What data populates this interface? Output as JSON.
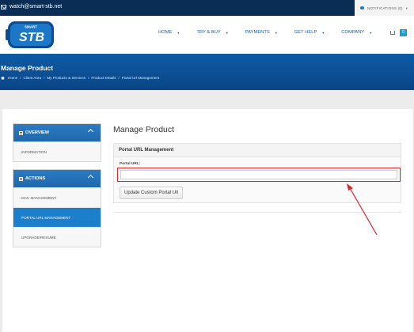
{
  "topbar": {
    "email": "watch@smart-stb.net",
    "notifications_label": "NOTIFICATIONS (0)"
  },
  "logo": {
    "top_text": "SMART",
    "main_text": "STB"
  },
  "nav": {
    "items": [
      {
        "label": "HOME"
      },
      {
        "label": "TRY & BUY"
      },
      {
        "label": "PAYMENTS"
      },
      {
        "label": "GET HELP"
      },
      {
        "label": "COMPANY"
      }
    ],
    "cart_count": "0"
  },
  "banner": {
    "title": "Manage Product",
    "breadcrumb": [
      "Home",
      "Client Area",
      "My Products & Services",
      "Product Details",
      "Portal Url Management"
    ]
  },
  "sidebar": {
    "overview": {
      "title": "OVERVIEW",
      "items": [
        {
          "label": "INFORMATION"
        }
      ]
    },
    "actions": {
      "title": "ACTIONS",
      "items": [
        {
          "label": "MAC MANAGEMENT"
        },
        {
          "label": "PORTAL URL MANAGEMENT"
        },
        {
          "label": "UPGRADE/RESUME"
        }
      ]
    }
  },
  "main": {
    "title": "Manage Product",
    "card_title": "Portal URL Management",
    "field_label": "Portal URL:",
    "field_value": "",
    "button_label": "Update Custom Portal Url"
  },
  "colors": {
    "topbar": "#0a2d55",
    "banner": "#0e5ba6",
    "accent": "#1b7fcc",
    "highlight": "#d9272e"
  }
}
